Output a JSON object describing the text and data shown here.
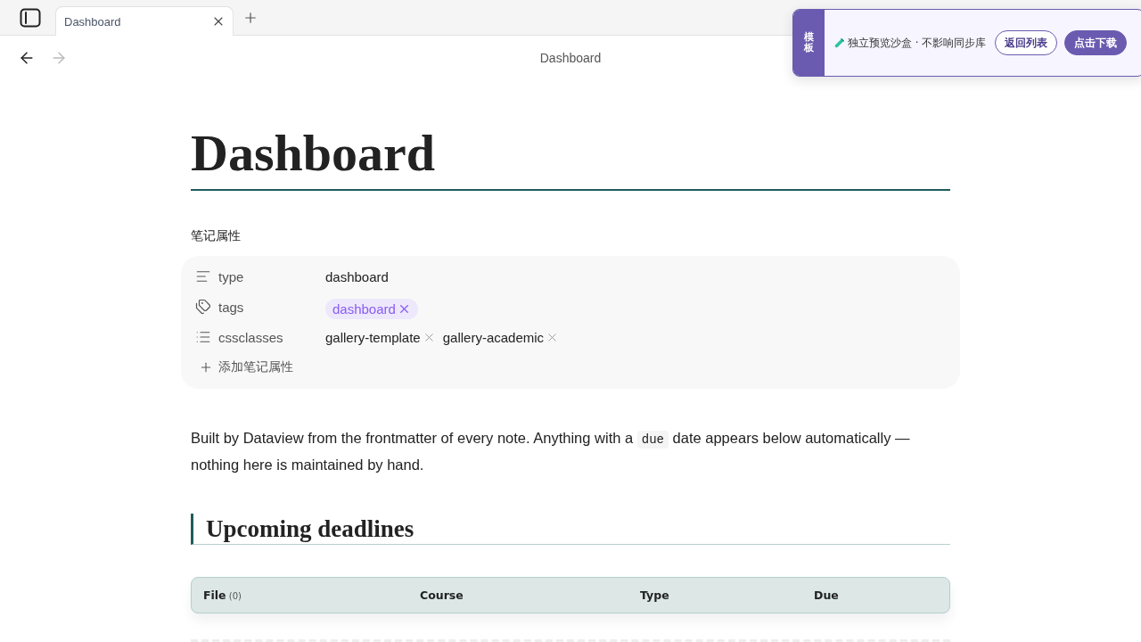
{
  "tab_bar": {
    "tabs": [
      {
        "title": "Dashboard",
        "selected": true
      }
    ]
  },
  "nav": {
    "title": "Dashboard",
    "back_disabled": false,
    "forward_disabled": true
  },
  "banner": {
    "badge": "模板",
    "message": "独立预览沙盒 · 不影响同步库",
    "buttons": [
      {
        "label": "返回列表",
        "kind": "outline"
      },
      {
        "label": "点击下载",
        "kind": "filled"
      }
    ]
  },
  "note": {
    "title": "Dashboard",
    "properties": {
      "heading": "笔记属性",
      "items": [
        {
          "key": "type",
          "kind": "text",
          "value": "dashboard"
        },
        {
          "key": "tags",
          "kind": "tags",
          "values": [
            "dashboard"
          ]
        },
        {
          "key": "cssclasses",
          "kind": "list",
          "values": [
            "gallery-template",
            "gallery-academic"
          ]
        }
      ],
      "add_label": "添加笔记属性"
    },
    "paragraph": [
      {
        "kind": "text",
        "text": "Built by Dataview from the frontmatter of every note. Anything with a "
      },
      {
        "kind": "code",
        "text": "due"
      },
      {
        "kind": "text",
        "text": " date appears below automatically — nothing here is maintained by hand."
      }
    ],
    "section": {
      "heading": "Upcoming deadlines",
      "table": {
        "columns": [
          {
            "label": "File",
            "count": "(0)"
          },
          {
            "label": "Course"
          },
          {
            "label": "Type"
          },
          {
            "label": "Due"
          }
        ]
      }
    }
  }
}
